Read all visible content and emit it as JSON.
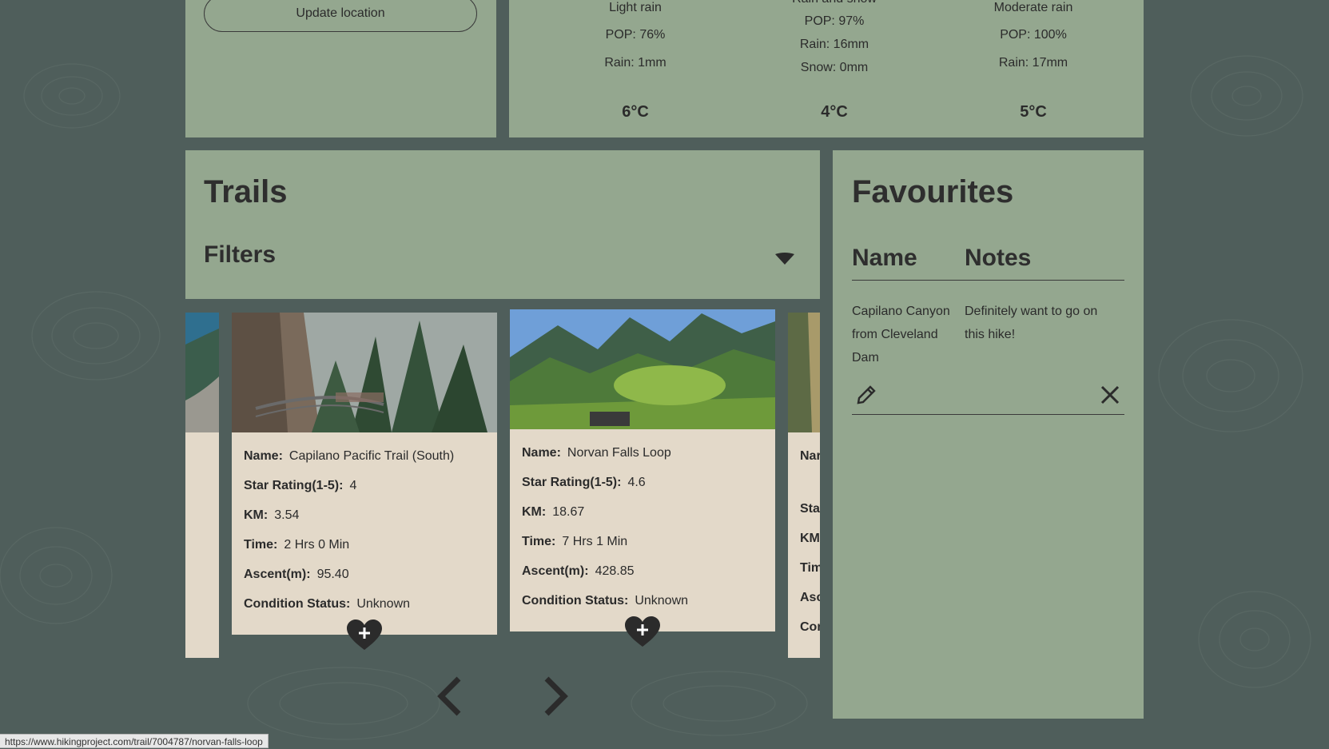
{
  "location": {
    "update_button": "Update location"
  },
  "forecast": [
    {
      "condition": "Light rain",
      "pop": "POP: 76%",
      "rain": "Rain: 1mm",
      "snow": "",
      "temp": "6°C"
    },
    {
      "condition": "Rain and snow",
      "pop": "POP: 97%",
      "rain": "Rain: 16mm",
      "snow": "Snow: 0mm",
      "temp": "4°C"
    },
    {
      "condition": "Moderate rain",
      "pop": "POP: 100%",
      "rain": "Rain: 17mm",
      "snow": "",
      "temp": "5°C"
    }
  ],
  "trails": {
    "title": "Trails",
    "filters_label": "Filters",
    "field_labels": {
      "name": "Name:",
      "stars": "Star Rating(1-5):",
      "km": "KM:",
      "time": "Time:",
      "ascent": "Ascent(m):",
      "condition": "Condition Status:"
    },
    "cards": [
      {
        "name": "Capilano Pacific Trail (South)",
        "stars": "4",
        "km": "3.54",
        "time": "2 Hrs 0 Min",
        "ascent": "95.40",
        "condition": "Unknown"
      },
      {
        "name": "Norvan Falls Loop",
        "stars": "4.6",
        "km": "18.67",
        "time": "7 Hrs 1 Min",
        "ascent": "428.85",
        "condition": "Unknown"
      }
    ],
    "partial_card_labels": [
      "Nar",
      "Sta",
      "KM",
      "Tim",
      "Asc",
      "Con"
    ]
  },
  "favourites": {
    "title": "Favourites",
    "col_name": "Name",
    "col_notes": "Notes",
    "items": [
      {
        "name_lines": [
          "Capilano Canyon",
          "from Cleveland",
          "Dam"
        ],
        "note_lines": [
          "Definitely want to go on",
          "this hike!"
        ]
      }
    ]
  },
  "icons": {
    "filters": "caret-down-icon",
    "favourite_add": "heart-plus-icon",
    "edit": "pencil-icon",
    "remove": "close-icon",
    "prev": "chevron-left-icon",
    "next": "chevron-right-icon"
  },
  "colors": {
    "background": "#4f5e5b",
    "panel": "#94a78f",
    "card": "#e3d9c9",
    "text": "#2b2b2b"
  },
  "status_bar": {
    "url": "https://www.hikingproject.com/trail/7004787/norvan-falls-loop"
  }
}
